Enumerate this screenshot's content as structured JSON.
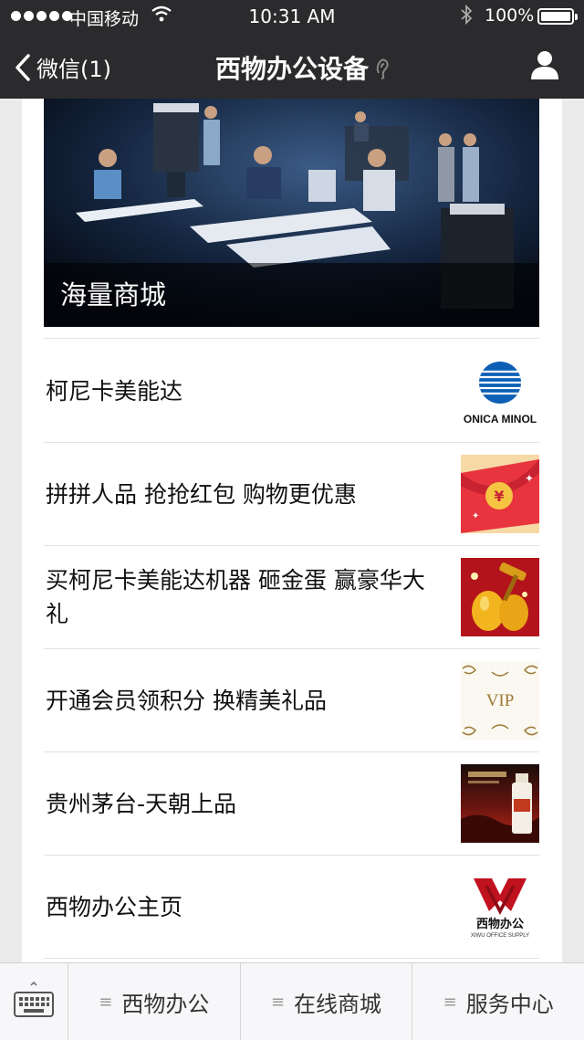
{
  "status": {
    "carrier": "中国移动",
    "time": "10:31 AM",
    "battery": "100%"
  },
  "nav": {
    "back_label": "微信(1)",
    "title": "西物办公设备"
  },
  "banner": {
    "caption": "海量商城"
  },
  "list": [
    {
      "text": "柯尼卡美能达",
      "thumb_text": "ONICA MINOL"
    },
    {
      "text": "拼拼人品 抢抢红包 购物更优惠",
      "thumb_text": "¥"
    },
    {
      "text": "买柯尼卡美能达机器 砸金蛋 赢豪华大礼",
      "thumb_text": ""
    },
    {
      "text": "开通会员领积分 换精美礼品",
      "thumb_text": "VIP"
    },
    {
      "text": "贵州茅台-天朝上品",
      "thumb_text": ""
    },
    {
      "text": "西物办公主页",
      "thumb_text": "西物办公",
      "thumb_subtext": "XIWU OFFICE SUPPLY"
    }
  ],
  "menu": [
    {
      "label": "西物办公"
    },
    {
      "label": "在线商城"
    },
    {
      "label": "服务中心"
    }
  ],
  "colors": {
    "topbar": "#2b2b2d",
    "background": "#ebebeb",
    "konica_blue": "#0b5fb4",
    "xiwu_red": "#c1121f"
  }
}
